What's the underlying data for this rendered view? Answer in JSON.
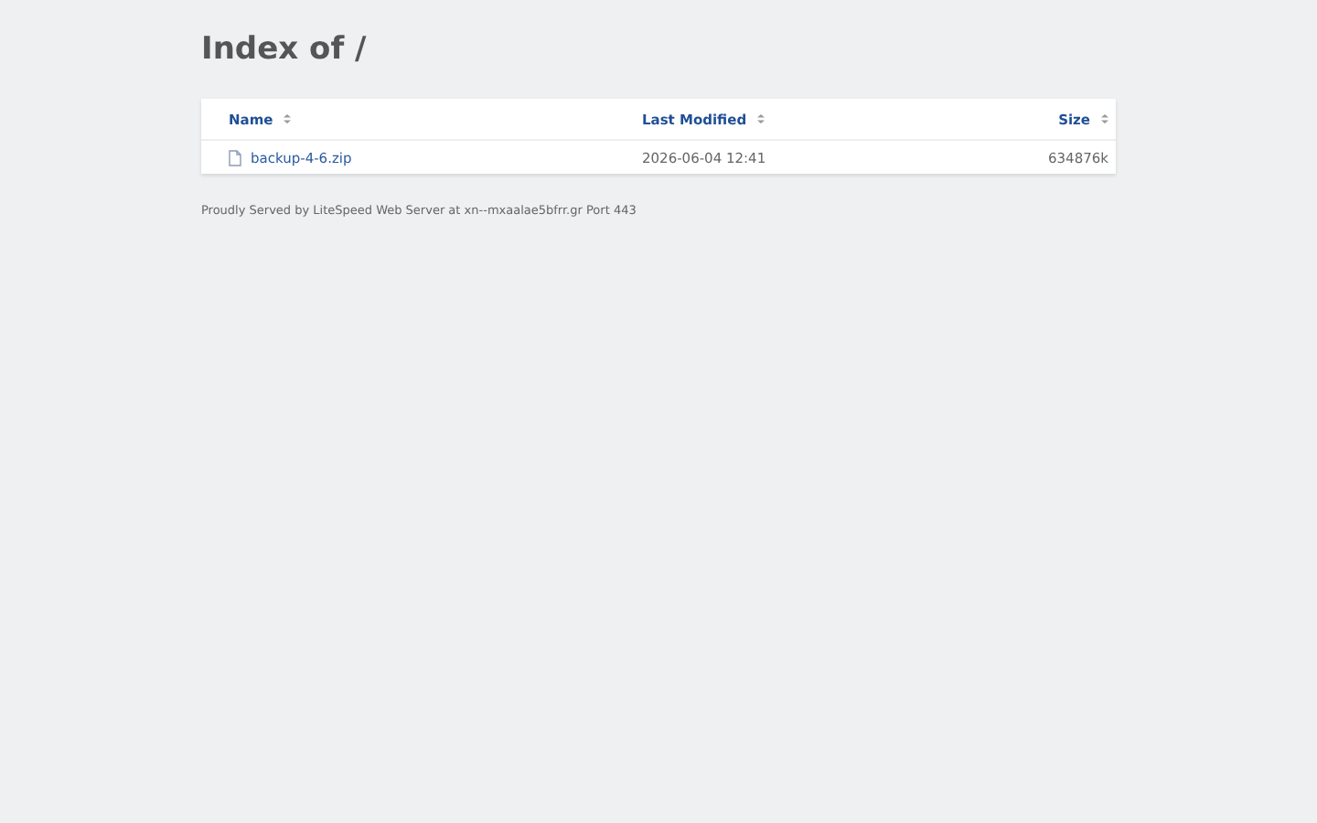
{
  "title": "Index of /",
  "table": {
    "columns": [
      {
        "label": "Name"
      },
      {
        "label": "Last Modified"
      },
      {
        "label": "Size"
      }
    ],
    "rows": [
      {
        "kind": "file",
        "name": "backup-4-6.zip",
        "modified": "2026-06-04 12:41",
        "size": "634876k"
      }
    ]
  },
  "footer": "Proudly Served by LiteSpeed Web Server at xn--mxaalae5bfrr.gr Port 443"
}
